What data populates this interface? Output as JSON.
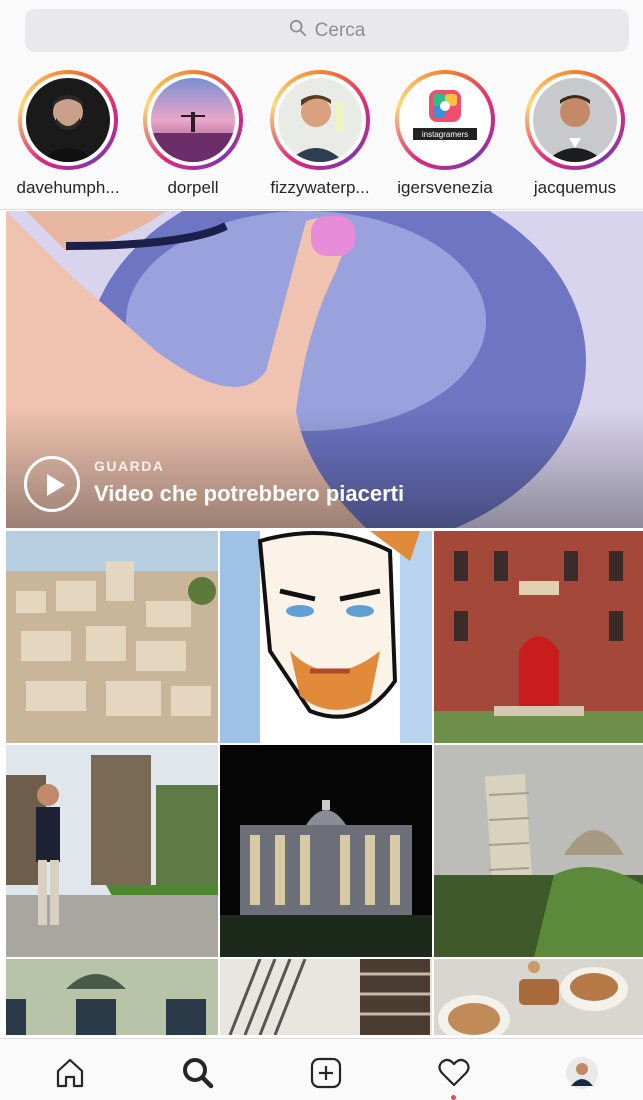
{
  "search": {
    "placeholder": "Cerca",
    "icon": "search-icon"
  },
  "stories": [
    {
      "username": "davehumph..."
    },
    {
      "username": "dorpell"
    },
    {
      "username": "fizzywaterp..."
    },
    {
      "username": "igersvenezia"
    },
    {
      "username": "jacquemus"
    }
  ],
  "video_banner": {
    "kicker": "GUARDA",
    "title": "Video che potrebbero piacerti",
    "icon": "play-icon"
  },
  "grid": {
    "tiles": [
      "hilltop-town-photo",
      "illustrated-face-artwork",
      "red-brick-building-photo",
      "man-by-castle-photo",
      "basilica-at-night-photo",
      "leaning-tower-photo",
      "building-windows-photo",
      "staircase-photo",
      "cappuccino-cookies-photo"
    ]
  },
  "tabbar": {
    "items": [
      "home-icon",
      "search-icon",
      "add-post-icon",
      "activity-heart-icon",
      "profile-avatar"
    ],
    "active": "search-icon",
    "notification_color": "#ed4956"
  },
  "colors": {
    "story_ring": "#dd2a7b",
    "background": "#fafafa"
  }
}
